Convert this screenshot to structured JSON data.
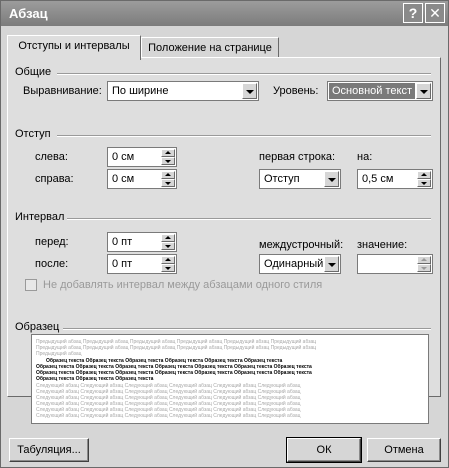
{
  "window": {
    "title": "Абзац",
    "help_icon": "question-icon",
    "close_icon": "close-icon",
    "help_glyph": "?",
    "close_glyph": "✕"
  },
  "tabs": [
    {
      "label": "Отступы и интервалы",
      "active": true
    },
    {
      "label": "Положение на странице",
      "active": false
    }
  ],
  "general": {
    "section": "Общие",
    "alignment_label": "Выравнивание:",
    "alignment_value": "По ширине",
    "level_label": "Уровень:",
    "level_value": "Основной текст"
  },
  "indent": {
    "section": "Отступ",
    "left_label": "слева:",
    "left_value": "0 см",
    "right_label": "справа:",
    "right_value": "0 см",
    "first_line_label": "первая строка:",
    "first_line_value": "Отступ",
    "by_label": "на:",
    "by_value": "0,5 см"
  },
  "spacing": {
    "section": "Интервал",
    "before_label": "перед:",
    "before_value": "0 пт",
    "after_label": "после:",
    "after_value": "0 пт",
    "line_label": "междустрочный:",
    "line_value": "Одинарный",
    "value_label": "значение:",
    "value_value": "",
    "no_space_label": "Не добавлять интервал между абзацами одного стиля"
  },
  "preview": {
    "section": "Образец",
    "prev_lines": [
      "Предыдущий абзац Предыдущий абзац Предыдущий абзац Предыдущий абзац Предыдущий абзац Предыдущий абзац",
      "Предыдущий абзац Предыдущий абзац Предыдущий абзац Предыдущий абзац Предыдущий абзац Предыдущий абзац",
      "Предыдущий абзац"
    ],
    "sample_lines": [
      "Образец текста Образец текста Образец текста Образец текста Образец текста Образец текста",
      "Образец текста Образец текста Образец текста Образец текста Образец текста Образец текста Образец текста",
      "Образец текста Образец текста Образец текста Образец текста Образец текста Образец текста Образец текста",
      "Образец текста Образец текста Образец текста"
    ],
    "next_lines": [
      "Следующий абзац Следующий абзац Следующий абзац Следующий абзац Следующий абзац Следующий абзац",
      "Следующий абзац Следующий абзац Следующий абзац Следующий абзац Следующий абзац Следующий абзац",
      "Следующий абзац Следующий абзац Следующий абзац Следующий абзац Следующий абзац Следующий абзац",
      "Следующий абзац Следующий абзац Следующий абзац Следующий абзац Следующий абзац Следующий абзац",
      "Следующий абзац Следующий абзац Следующий абзац Следующий абзац Следующий абзац Следующий абзац",
      "Следующий абзац Следующий абзац Следующий абзац Следующий абзац Следующий абзац Следующий абзац"
    ]
  },
  "buttons": {
    "tabs": "Табуляция...",
    "ok": "ОК",
    "cancel": "Отмена"
  }
}
